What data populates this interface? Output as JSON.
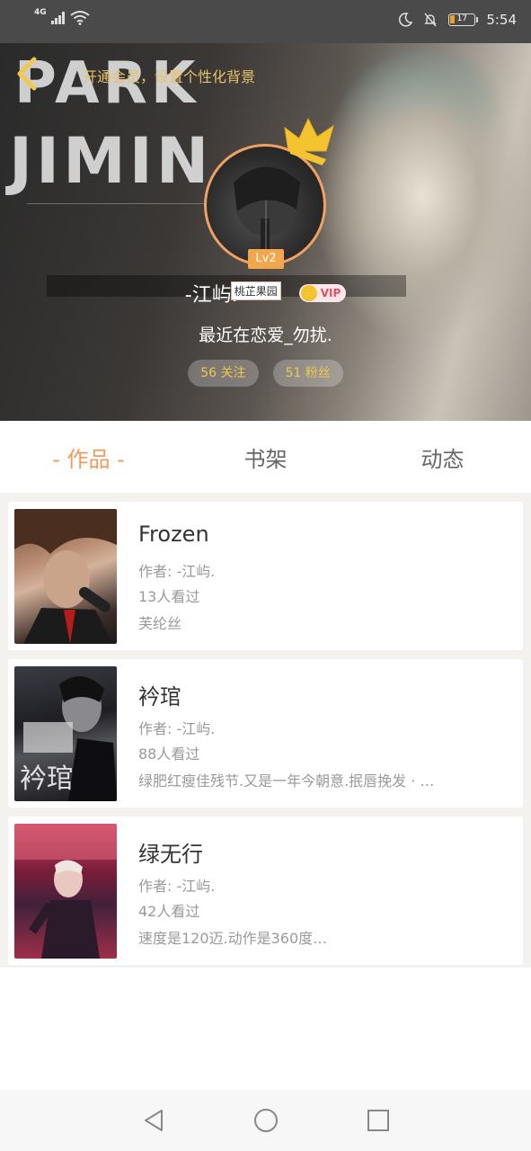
{
  "status_bar": {
    "network": "4G",
    "time": "5:54",
    "battery": "17"
  },
  "header": {
    "bg_words": [
      "PARK",
      "JIMIN"
    ],
    "vip_banner": "开通会员，设置个性化背景",
    "level": "Lv2",
    "username": "-江屿.",
    "name_tag": "桃芷果园",
    "vip_label": "VIP",
    "signature": "最近在恋爱_勿扰.",
    "following": "56 关注",
    "followers": "51 粉丝"
  },
  "tabs": [
    {
      "label": "- 作品 -",
      "active": true
    },
    {
      "label": "书架",
      "active": false
    },
    {
      "label": "动态",
      "active": false
    }
  ],
  "works": [
    {
      "title": "Frozen",
      "author": "作者: -江屿.",
      "views": "13人看过",
      "desc": "芙纶丝"
    },
    {
      "title": "衿琯",
      "author": "作者: -江屿.",
      "views": "88人看过",
      "desc": "绿肥红瘦佳残节.又是一年今朝意.抿唇挽发 · …"
    },
    {
      "title": "绿无行",
      "author": "作者: -江屿.",
      "views": "42人看过",
      "desc": "速度是120迈.动作是360度…"
    }
  ],
  "colors": {
    "accent": "#f19a5d",
    "gold": "#f1c84e",
    "vip_pink": "#e0506a"
  }
}
